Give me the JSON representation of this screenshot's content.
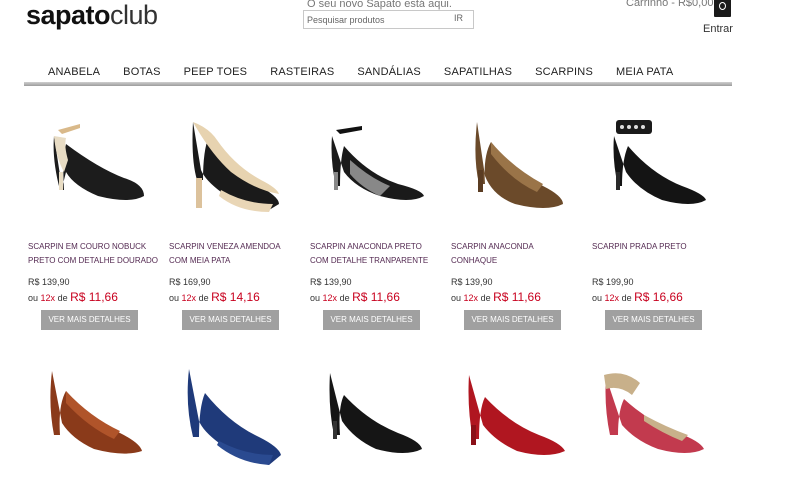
{
  "header": {
    "logo_bold": "sapato",
    "logo_light": "club",
    "tagline": "O seu novo Sapato está aqui.",
    "search_placeholder": "Pesquisar produtos",
    "search_button": "IR",
    "cart_text": "Carrinho - R$0,00",
    "login": "Entrar"
  },
  "nav": [
    "ANABELA",
    "BOTAS",
    "PEEP TOES",
    "RASTEIRAS",
    "SANDÁLIAS",
    "SAPATILHAS",
    "SCARPINS",
    "MEIA PATA"
  ],
  "products": [
    {
      "name": "SCARPIN EM COURO NOBUCK PRETO COM DETALHE DOURADO",
      "price": "R$ 139,90",
      "installments_prefix": "ou",
      "installments_count": "12x",
      "installments_de": "de",
      "installment_value": "R$ 11,66",
      "button": "VER MAIS DETALHES"
    },
    {
      "name": "SCARPIN VENEZA AMENDOA COM MEIA PATA",
      "price": "R$ 169,90",
      "installments_prefix": "ou",
      "installments_count": "12x",
      "installments_de": "de",
      "installment_value": "R$ 14,16",
      "button": "VER MAIS DETALHES"
    },
    {
      "name": "SCARPIN ANACONDA PRETO COM DETALHE TRANPARENTE",
      "price": "R$ 139,90",
      "installments_prefix": "ou",
      "installments_count": "12x",
      "installments_de": "de",
      "installment_value": "R$ 11,66",
      "button": "VER MAIS DETALHES"
    },
    {
      "name": "SCARPIN ANACONDA CONHAQUE",
      "price": "R$ 139,90",
      "installments_prefix": "ou",
      "installments_count": "12x",
      "installments_de": "de",
      "installment_value": "R$ 11,66",
      "button": "VER MAIS DETALHES"
    },
    {
      "name": "SCARPIN PRADA PRETO",
      "price": "R$ 199,90",
      "installments_prefix": "ou",
      "installments_count": "12x",
      "installments_de": "de",
      "installment_value": "R$ 16,66",
      "button": "VER MAIS DETALHES"
    }
  ],
  "colors": {
    "accent_red": "#c8001e",
    "product_name": "#542a52",
    "button_gray": "#a0a0a0"
  }
}
